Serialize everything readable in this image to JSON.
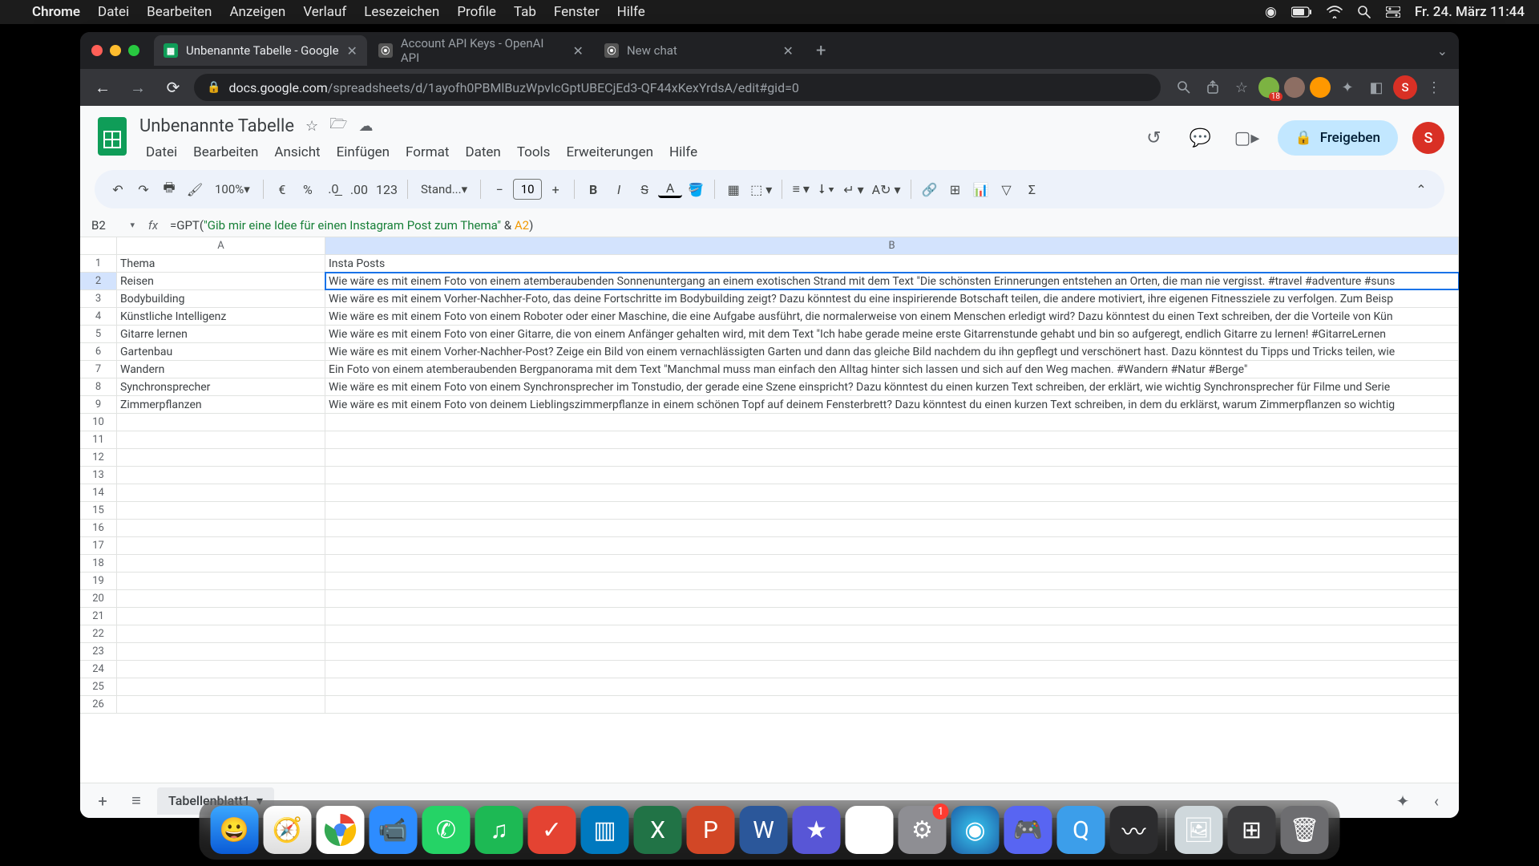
{
  "mac": {
    "app": "Chrome",
    "menus": [
      "Datei",
      "Bearbeiten",
      "Anzeigen",
      "Verlauf",
      "Lesezeichen",
      "Profile",
      "Tab",
      "Fenster",
      "Hilfe"
    ],
    "clock": "Fr. 24. März  11:44"
  },
  "chrome": {
    "tabs": [
      {
        "title": "Unbenannte Tabelle - Google",
        "active": true
      },
      {
        "title": "Account API Keys - OpenAI API",
        "active": false
      },
      {
        "title": "New chat",
        "active": false
      }
    ],
    "url_domain": "docs.google.com",
    "url_path": "/spreadsheets/d/1ayofh0PBMlBuzWpvIcGptUBECjEd3-QF44xKexYrdsA/edit#gid=0",
    "ext_badge": "18",
    "avatar_letter": "S"
  },
  "sheets": {
    "doc_title": "Unbenannte Tabelle",
    "menus": [
      "Datei",
      "Bearbeiten",
      "Ansicht",
      "Einfügen",
      "Format",
      "Daten",
      "Tools",
      "Erweiterungen",
      "Hilfe"
    ],
    "share_label": "Freigeben",
    "avatar_letter": "S",
    "toolbar": {
      "zoom": "100%",
      "font_name": "Stand...",
      "font_size": "10",
      "number_fmt": "123"
    },
    "name_box": "B2",
    "formula": {
      "prefix": "=GPT(",
      "string": "\"Gib mir eine Idee für einen Instagram Post zum Thema\"",
      "concat": " & ",
      "ref": "A2",
      "suffix": ")"
    },
    "columns": [
      "A",
      "B"
    ],
    "rows": [
      {
        "n": 1,
        "A": "Thema",
        "B": "Insta Posts"
      },
      {
        "n": 2,
        "A": "Reisen",
        "B": "Wie wäre es mit einem Foto von einem atemberaubenden Sonnenuntergang an einem exotischen Strand mit dem Text \"Die schönsten Erinnerungen entstehen an Orten, die man nie vergisst. #travel #adventure #suns"
      },
      {
        "n": 3,
        "A": "Bodybuilding",
        "B": "Wie wäre es mit einem Vorher-Nachher-Foto, das deine Fortschritte im Bodybuilding zeigt? Dazu könntest du eine inspirierende Botschaft teilen, die andere motiviert, ihre eigenen Fitnessziele zu verfolgen. Zum Beisp"
      },
      {
        "n": 4,
        "A": "Künstliche Intelligenz",
        "B": "Wie wäre es mit einem Foto von einem Roboter oder einer Maschine, die eine Aufgabe ausführt, die normalerweise von einem Menschen erledigt wird? Dazu könntest du einen Text schreiben, der die Vorteile von Kün"
      },
      {
        "n": 5,
        "A": "Gitarre lernen",
        "B": "Wie wäre es mit einem Foto von einer Gitarre, die von einem Anfänger gehalten wird, mit dem Text \"Ich habe gerade meine erste Gitarrenstunde gehabt und bin so aufgeregt, endlich Gitarre zu lernen! #GitarreLernen"
      },
      {
        "n": 6,
        "A": "Gartenbau",
        "B": "Wie wäre es mit einem Vorher-Nachher-Post? Zeige ein Bild von einem vernachlässigten Garten und dann das gleiche Bild nachdem du ihn gepflegt und verschönert hast. Dazu könntest du Tipps und Tricks teilen, wie"
      },
      {
        "n": 7,
        "A": "Wandern",
        "B": "Ein Foto von einem atemberaubenden Bergpanorama mit dem Text \"Manchmal muss man einfach den Alltag hinter sich lassen und sich auf den Weg machen. #Wandern #Natur #Berge\""
      },
      {
        "n": 8,
        "A": "Synchronsprecher",
        "B": "Wie wäre es mit einem Foto von einem Synchronsprecher im Tonstudio, der gerade eine Szene einspricht? Dazu könntest du einen kurzen Text schreiben, der erklärt, wie wichtig Synchronsprecher für Filme und Serie"
      },
      {
        "n": 9,
        "A": "Zimmerpflanzen",
        "B": "Wie wäre es mit einem Foto von deinem Lieblingszimmerpflanze in einem schönen Topf auf deinem Fensterbrett? Dazu könntest du einen kurzen Text schreiben, in dem du erklärst, warum Zimmerpflanzen so wichtig"
      }
    ],
    "empty_rows": [
      10,
      11,
      12,
      13,
      14,
      15,
      16,
      17,
      18,
      19,
      20,
      21,
      22,
      23,
      24,
      25,
      26
    ],
    "selected_row": 2,
    "sheet_tab": "Tabellenblatt1"
  },
  "dock": {
    "settings_badge": "1"
  }
}
